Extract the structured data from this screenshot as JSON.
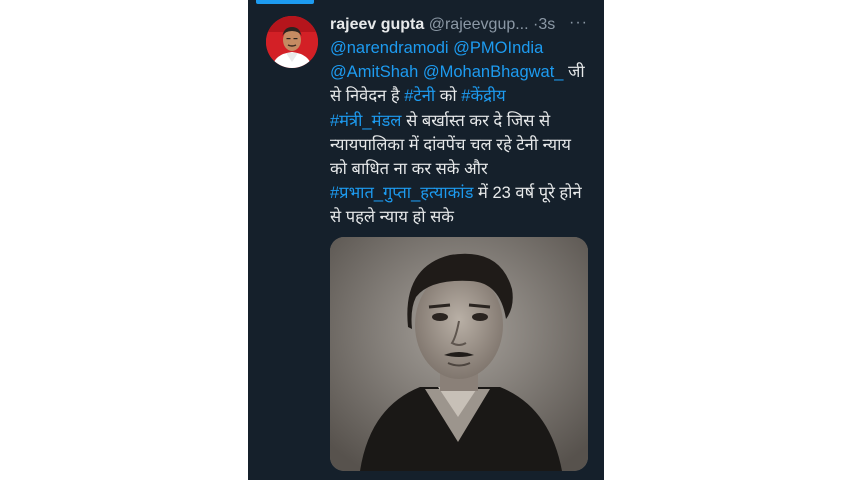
{
  "tweet": {
    "author_name": "rajeev gupta",
    "handle": "@rajeevgup...",
    "separator": "·",
    "time": "3s",
    "more": "···",
    "mention_1": "@narendramodi",
    "mention_2": "@PMOIndia",
    "mention_3": "@AmitShah",
    "mention_4": "@MohanBhagwat_",
    "text_1": "जी",
    "text_2": "से निवेदन है",
    "hashtag_1": "#टेनी",
    "text_3": "को",
    "hashtag_2": "#केंद्रीय",
    "hashtag_3": "#मंत्री_मंडल",
    "text_4": "से बर्खास्त कर दे जिस से",
    "text_5": "न्यायपालिका में दांवपेंच चल रहे टेनी न्याय",
    "text_6": "को बाधित ना कर सके  और",
    "hashtag_4": "#प्रभात_गुप्ता_हत्याकांड",
    "text_7": "में 23 वर्ष पूरे होने",
    "text_8": "से पहले न्याय हो सके"
  },
  "colors": {
    "background": "#15202b",
    "text": "#e7e9ea",
    "secondary": "#8b98a5",
    "link": "#1d9bf0"
  },
  "icons": {
    "more": "more-dots-icon"
  }
}
